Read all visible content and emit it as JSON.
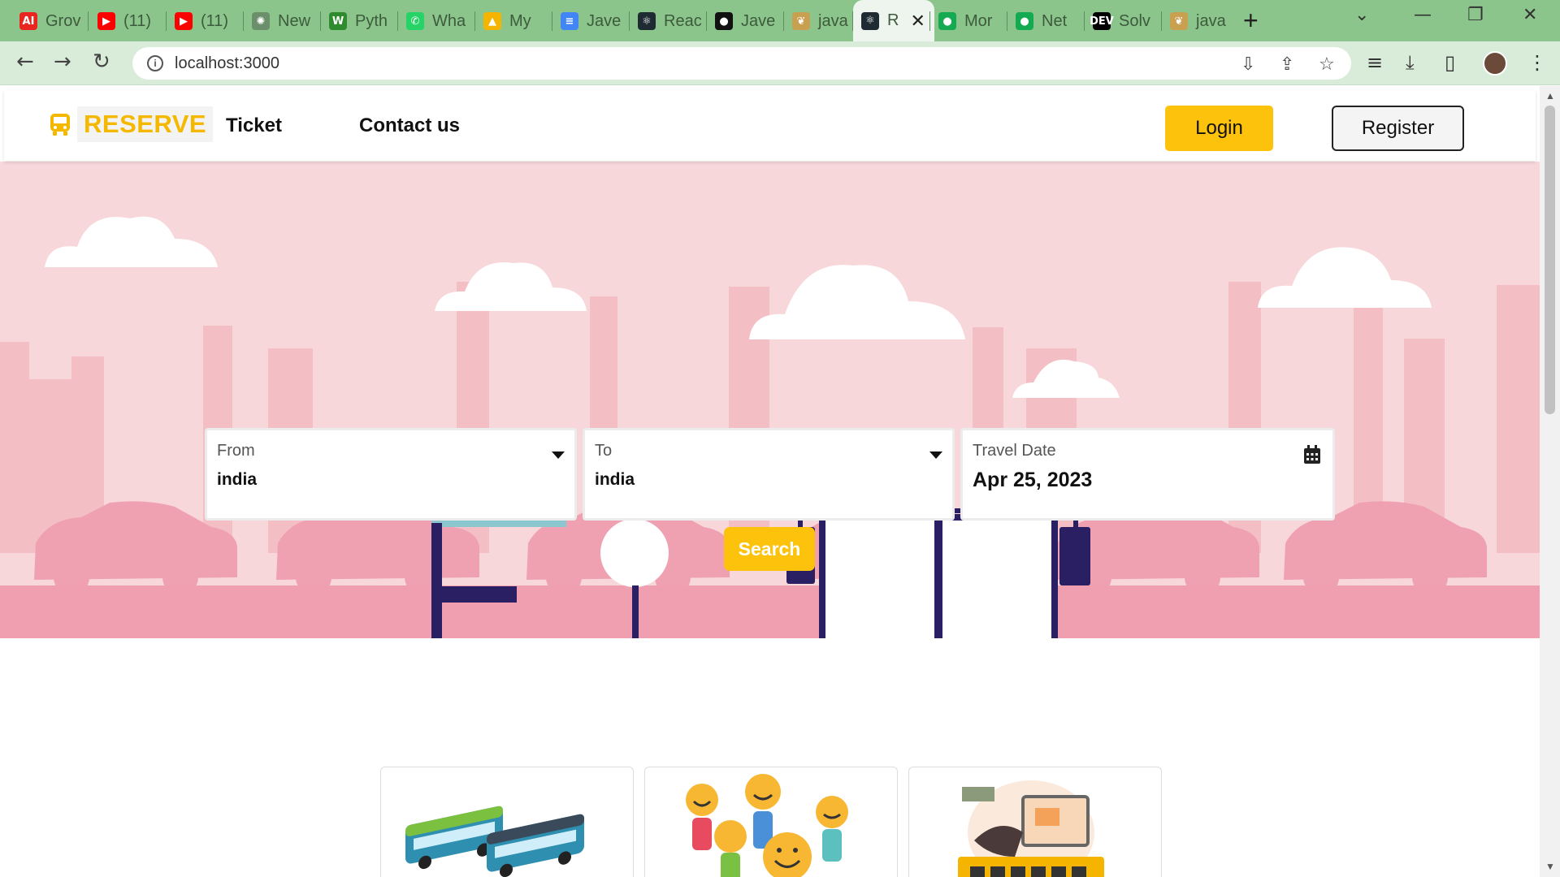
{
  "browser": {
    "tabs": [
      {
        "label": "Grov",
        "icon": "ai-icon",
        "color": "#e8261f",
        "glyph": "AI"
      },
      {
        "label": "(11)",
        "icon": "youtube-icon",
        "color": "#ff0000",
        "glyph": "▶"
      },
      {
        "label": "(11)",
        "icon": "youtube-icon",
        "color": "#ff0000",
        "glyph": "▶"
      },
      {
        "label": "New",
        "icon": "openai-icon",
        "color": "#6b8f6b",
        "glyph": "✺"
      },
      {
        "label": "Pyth",
        "icon": "w3-icon",
        "color": "#2e8b2e",
        "glyph": "W"
      },
      {
        "label": "Wha",
        "icon": "whatsapp-icon",
        "color": "#25d366",
        "glyph": "✆"
      },
      {
        "label": "My",
        "icon": "drive-icon",
        "color": "#f4b400",
        "glyph": "▲"
      },
      {
        "label": "Jave",
        "icon": "docs-icon",
        "color": "#4285f4",
        "glyph": "≡"
      },
      {
        "label": "Reac",
        "icon": "react-icon",
        "color": "#1f2b33",
        "glyph": "⚛"
      },
      {
        "label": "Jave",
        "icon": "github-icon",
        "color": "#111111",
        "glyph": "●"
      },
      {
        "label": "java",
        "icon": "leaf-icon",
        "color": "#c8a050",
        "glyph": "❦"
      },
      {
        "label": "R",
        "icon": "react-icon",
        "color": "#1f2b33",
        "glyph": "⚛",
        "active": true
      },
      {
        "label": "Mor",
        "icon": "mongodb-icon",
        "color": "#13aa52",
        "glyph": "●"
      },
      {
        "label": "Net",
        "icon": "mongodb-icon",
        "color": "#13aa52",
        "glyph": "●"
      },
      {
        "label": "Solv",
        "icon": "dev-icon",
        "color": "#000000",
        "glyph": "DEV"
      },
      {
        "label": "java",
        "icon": "leaf-icon",
        "color": "#c8a050",
        "glyph": "❦"
      }
    ],
    "url": "localhost:3000"
  },
  "navbar": {
    "brand": "RESERVE",
    "links": [
      "Ticket",
      "Contact us"
    ],
    "login_label": "Login",
    "register_label": "Register"
  },
  "search": {
    "from_label": "From",
    "from_value": "india",
    "to_label": "To",
    "to_value": "india",
    "date_label": "Travel Date",
    "date_value": "Apr 25, 2023",
    "button_label": "Search"
  },
  "colors": {
    "accent": "#fcc20c",
    "hero_bg": "#f7d7da",
    "ground": "#f09fb0",
    "bus_dark": "#2b1f63"
  }
}
